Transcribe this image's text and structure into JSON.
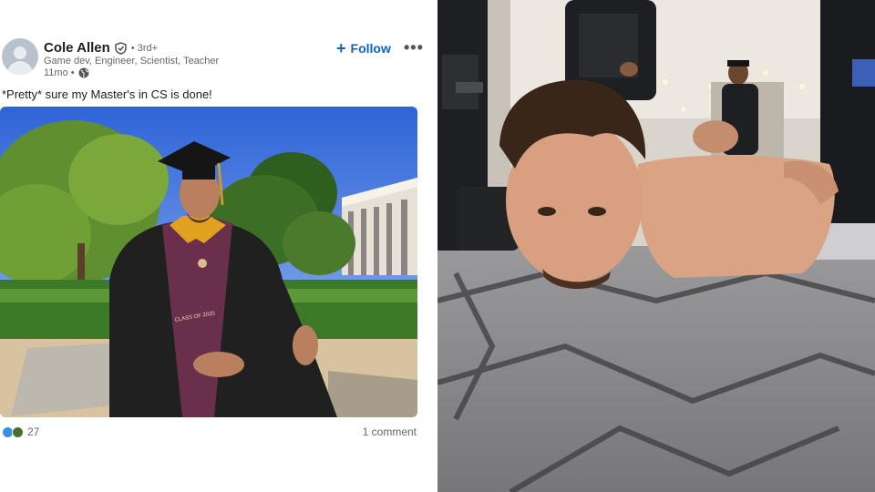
{
  "post": {
    "author": "Cole Allen",
    "degree": "• 3rd+",
    "headline": "Game dev, Engineer, Scientist,  Teacher",
    "time": "11mo •",
    "follow_label": "Follow",
    "more_label": "•••",
    "text": "*Pretty* sure my Master's in CS is done!",
    "reactions_count": "27",
    "comments_label": "1 comment",
    "stole_text": "CLASS OF 2025"
  },
  "colors": {
    "accent": "#0a66c2",
    "like": "#378fe9",
    "celebrate": "#44712e"
  },
  "icons": {
    "verified": "shield-check-icon",
    "visibility": "globe-icon",
    "follow": "plus-icon",
    "more": "ellipsis-icon"
  }
}
